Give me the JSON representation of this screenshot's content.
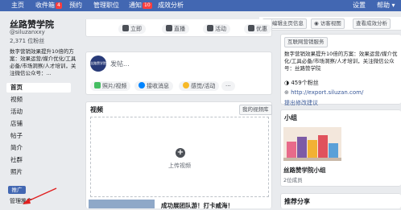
{
  "topbar": {
    "items": [
      {
        "label": "主页",
        "badge": ""
      },
      {
        "label": "收件箱",
        "badge": "4"
      },
      {
        "label": "预约",
        "badge": ""
      },
      {
        "label": "管理职位",
        "badge": ""
      },
      {
        "label": "通知",
        "badge": "10"
      },
      {
        "label": "成效分析",
        "badge": ""
      },
      {
        "label": "设置",
        "badge": ""
      },
      {
        "label": "帮助",
        "badge": ""
      }
    ]
  },
  "page": {
    "name": "丝路赞学院",
    "handle": "@siluzanxxy",
    "likes": "2,371 位粉丝",
    "description": "数字营销效果提升10倍的方案：效果运营/媒介优化/工具必备/市场洞察/人才培训，关注微信公众号：..."
  },
  "nav": {
    "items": [
      "首页",
      "视频",
      "活动",
      "店铺",
      "帖子",
      "简介",
      "社群",
      "照片"
    ],
    "promote_button": "推广",
    "manage_promotions": "管理推广"
  },
  "page_tabs": {
    "edit_info": "编辑主页信息",
    "visitor_view": "访客视图",
    "insights": "查看成效分析"
  },
  "composer": {
    "avatar_text": "丝路赞学院",
    "placeholder": "发帖...",
    "actions": [
      "照片/视频",
      "接收消息",
      "感觉/活动"
    ],
    "more": "···",
    "top_pills": [
      "立即",
      "直播",
      "活动",
      "优惠"
    ]
  },
  "videos": {
    "title": "视频",
    "library_button": "我的视频库",
    "upload_label": "上传视频"
  },
  "feed": {
    "post_title": "成功展团队游！打卡威海！"
  },
  "about": {
    "section_label": "互联网营销服务",
    "description": "数字营销效果提升10倍的方案：效果运营/媒介优化/工具必备/市场洞察/人才培训，关注微信公众号：丝路赞学院",
    "followers": "459个粉丝",
    "website": "http://export.siluzan.com/",
    "suggest_edits": "提出修改建议"
  },
  "groups": {
    "title": "小组",
    "group_name": "丝路赞学院小组",
    "group_members": "2位成员"
  },
  "recommended": {
    "title": "推荐分享"
  },
  "colors": {
    "brand_blue": "#4267b2",
    "badge_red": "#fa3e3e",
    "background": "#e9ebee"
  }
}
